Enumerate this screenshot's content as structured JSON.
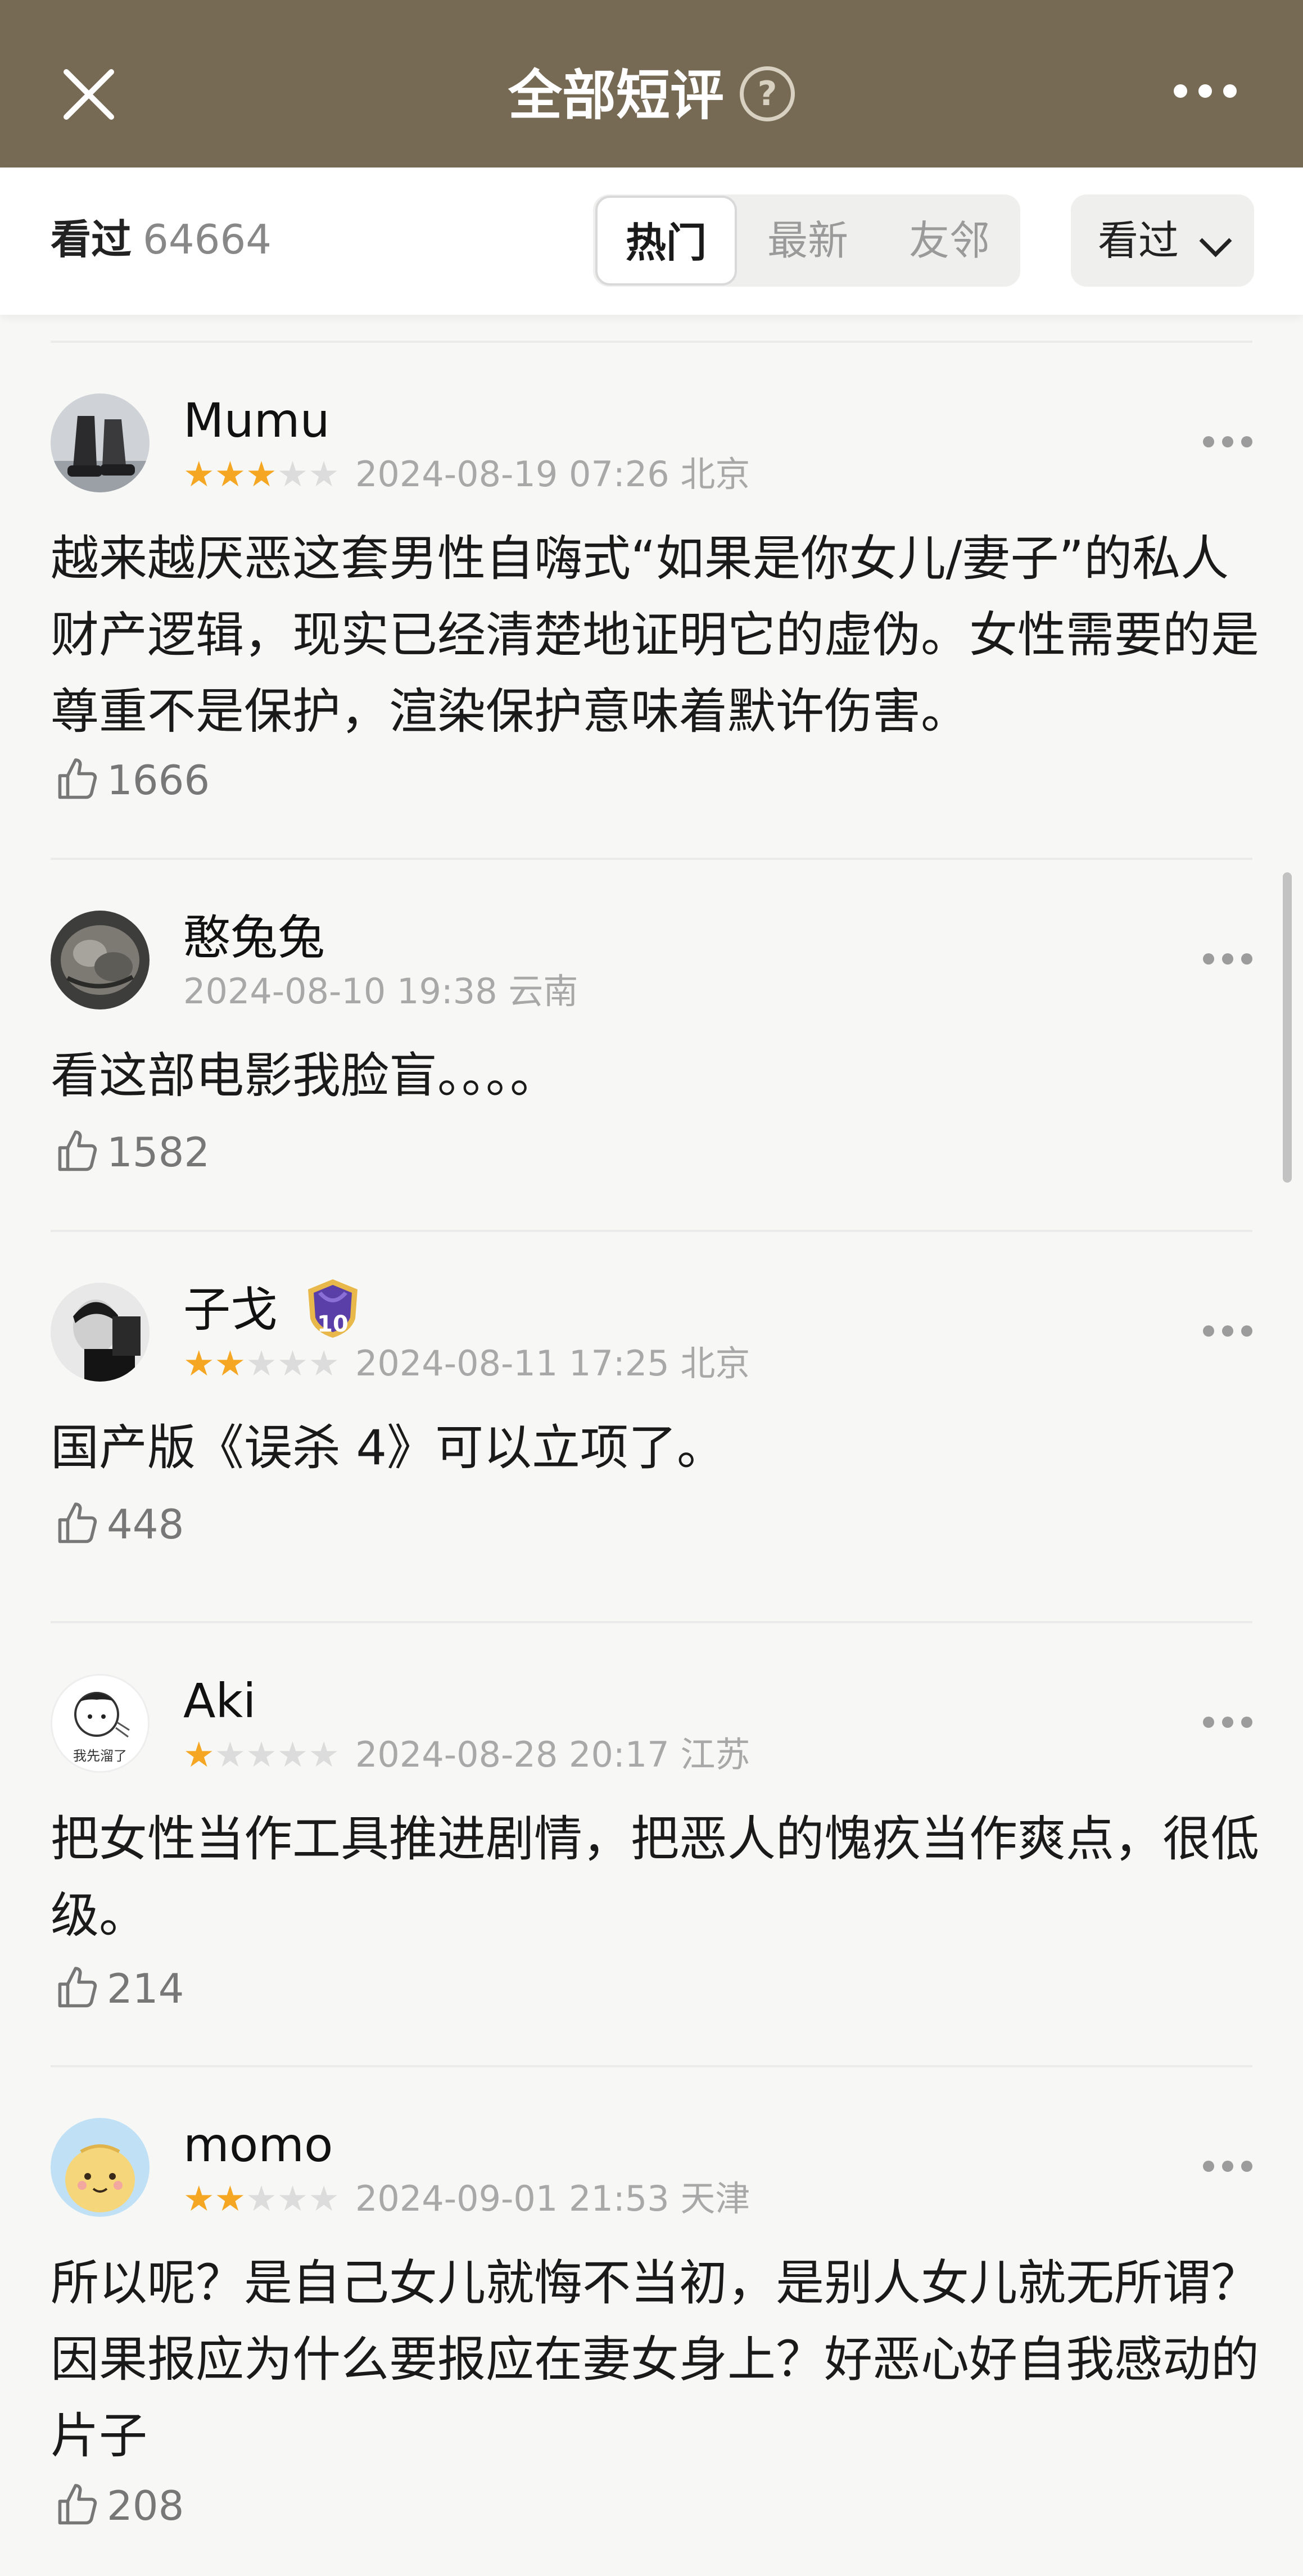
{
  "header": {
    "title": "全部短评",
    "help": "?"
  },
  "filter": {
    "seen_label": "看过",
    "seen_count": "64664",
    "tabs": [
      {
        "label": "热门",
        "active": true
      },
      {
        "label": "最新",
        "active": false
      },
      {
        "label": "友邻",
        "active": false
      }
    ],
    "dropdown_label": "看过"
  },
  "comments": [
    {
      "user": "Mumu",
      "rating": 3,
      "time": "2024-08-19 07:26",
      "location": "北京",
      "text": "越来越厌恶这套男性自嗨式“如果是你女儿/妻子”的私人财产逻辑，现实已经清楚地证明它的虚伪。女性需要的是尊重不是保护，渲染保护意味着默许伤害。",
      "likes": "1666"
    },
    {
      "user": "憨兔兔",
      "rating": 0,
      "time": "2024-08-10 19:38",
      "location": "云南",
      "text": "看这部电影我脸盲。。。。",
      "likes": "1582"
    },
    {
      "user": "子戈",
      "badge": "10",
      "rating": 2,
      "time": "2024-08-11 17:25",
      "location": "北京",
      "text": "国产版《误杀 4》可以立项了。",
      "likes": "448"
    },
    {
      "user": "Aki",
      "avatar_caption": "我先溜了",
      "rating": 1,
      "time": "2024-08-28 20:17",
      "location": "江苏",
      "text": "把女性当作工具推进剧情，把恶人的愧疚当作爽点，很低级。",
      "likes": "214"
    },
    {
      "user": "momo",
      "rating": 2,
      "time": "2024-09-01 21:53",
      "location": "天津",
      "text": "所以呢？是自己女儿就悔不当初，是别人女儿就无所谓？因果报应为什么要报应在妻女身上？好恶心好自我感动的片子",
      "likes": "208"
    }
  ],
  "colors": {
    "header_bg": "#776a55",
    "star_on": "#f5a623",
    "star_off": "#dcdcdc"
  }
}
